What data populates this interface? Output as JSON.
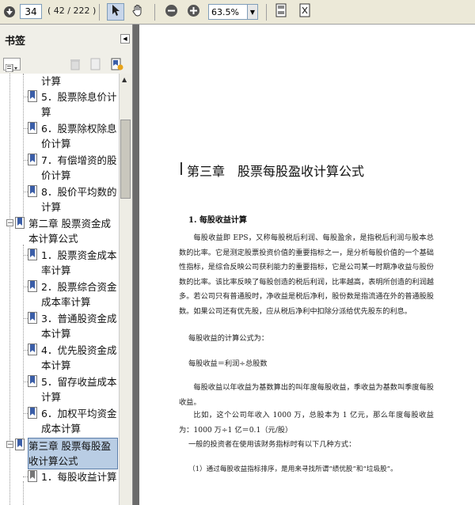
{
  "toolbar": {
    "page_number": "34",
    "page_count": "( 42 / 222 )",
    "zoom": "63.5%"
  },
  "bookmarks_panel": {
    "title": "书签",
    "items": [
      {
        "label": "计算"
      },
      {
        "label": "5．股票除息价计算"
      },
      {
        "label": "6．股票除权除息价计算"
      },
      {
        "label": "7．有偿增资的股价计算"
      },
      {
        "label": "8．股价平均数的计算"
      },
      {
        "label": "第二章 股票资金成本计算公式"
      },
      {
        "label": "1．股票资金成本率计算"
      },
      {
        "label": "2．股票综合资金成本率计算"
      },
      {
        "label": "3．普通股资金成本计算"
      },
      {
        "label": "4．优先股资金成本计算"
      },
      {
        "label": "5．留存收益成本计算"
      },
      {
        "label": "6．加权平均资金成本计算"
      },
      {
        "label": "第三章 股票每股盈收计算公式"
      },
      {
        "label": "1．每股收益计算"
      }
    ]
  },
  "document": {
    "chapter_title": "第三章　股票每股盈收计算公式",
    "section_title": "1. 每股收益计算",
    "para1": "每股收益即 EPS，又称每股税后利润、每股盈余，是指税后利润与股本总数的比率。它是测定股票投资价值的重要指标之一，是分析每股价值的一个基础性指标，是综合反映公司获利能力的重要指标，它是公司某一时期净收益与股份数的比率。该比率反映了每股创造的税后利润，比率越高，表明所创造的利润越多。若公司只有普通股时，净收益是税后净利，股份数是指流通在外的普通股股数。如果公司还有优先股，应从税后净利中扣除分派给优先股东的利息。",
    "line_formula_intro": "每股收益的计算公式为：",
    "line_formula": "每股收益＝利润÷总股数",
    "para2": "每股收益以年收益为基数算出的叫年度每股收益，季收益为基数叫季度每股收益。",
    "para3": "比如，这个公司年收入 1000 万，总股本为 1 亿元，那么年度每股收益为：1000 万÷1 亿＝0.1（元/股）",
    "line_method_intro": "一般的投资者在使用该财务指标时有以下几种方式：",
    "line_method_1": "（1）通过每股收益指标排序，是用来寻找所谓“绩优股”和“垃圾股”。"
  }
}
